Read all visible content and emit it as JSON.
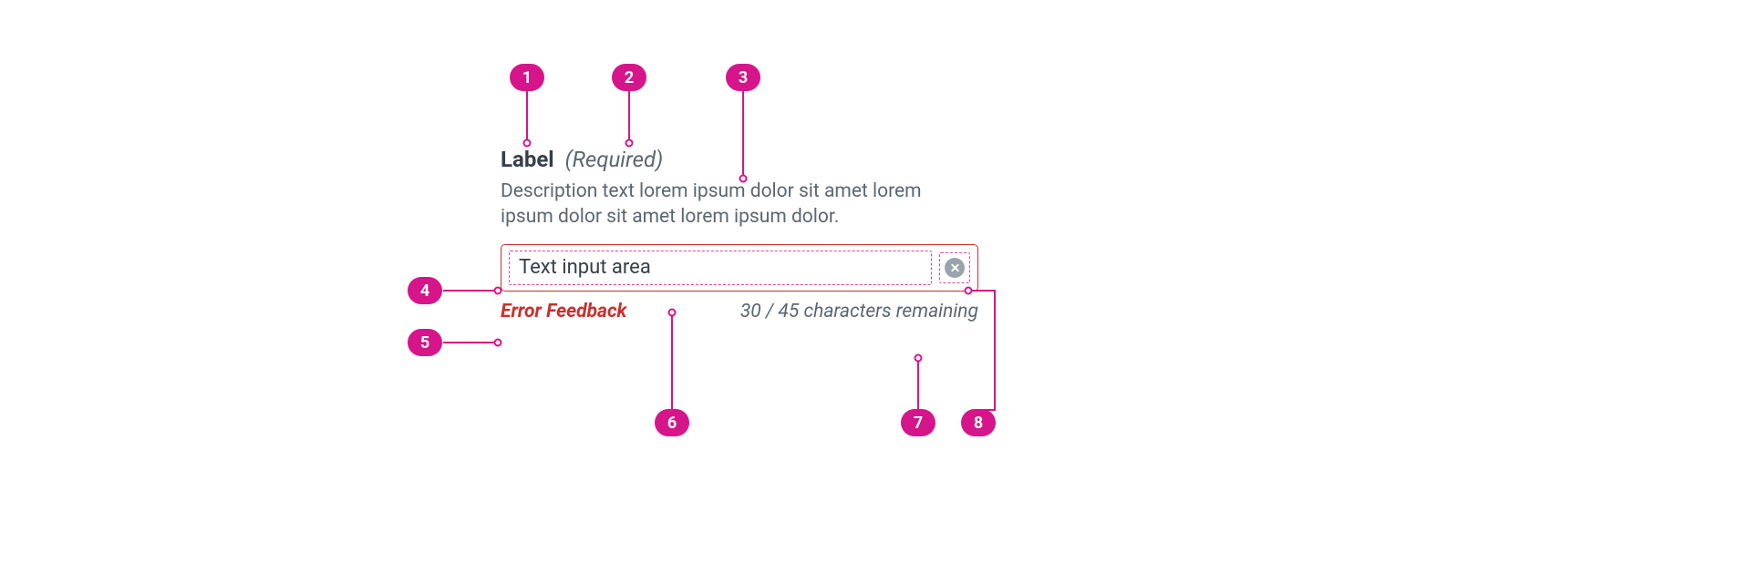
{
  "badges": {
    "b1": "1",
    "b2": "2",
    "b3": "3",
    "b4": "4",
    "b5": "5",
    "b6": "6",
    "b7": "7",
    "b8": "8"
  },
  "field": {
    "label": "Label",
    "required_marker": "(Required)",
    "description": "Description text lorem ipsum dolor sit amet lorem ipsum dolor sit amet lorem ipsum dolor.",
    "input_value": "Text input area",
    "error": "Error Feedback",
    "char_count": "30 / 45 characters remaining"
  }
}
